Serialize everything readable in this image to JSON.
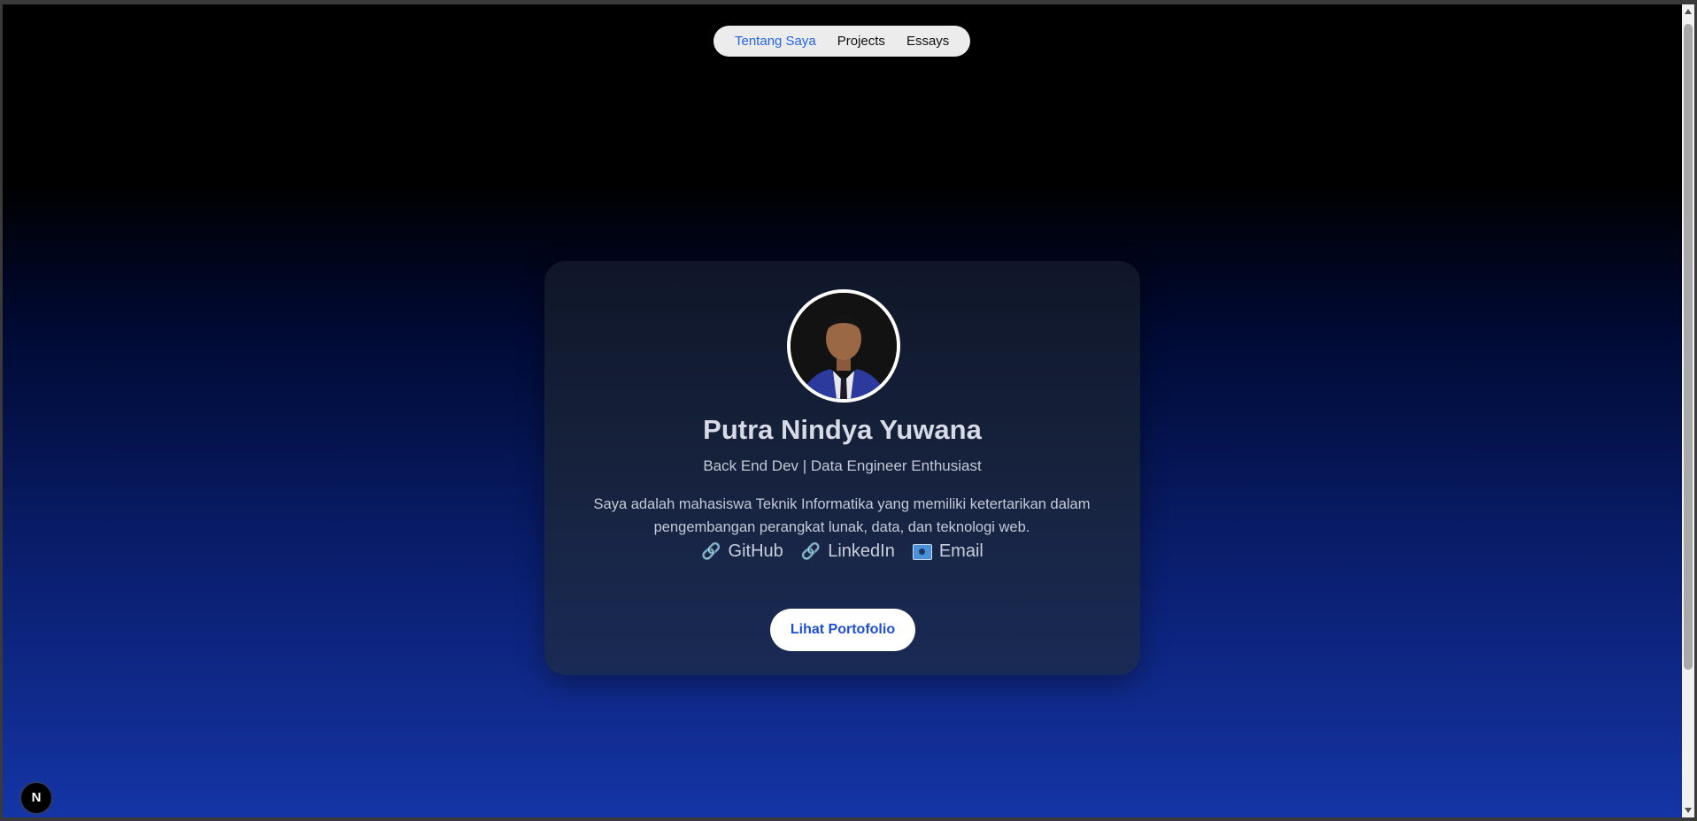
{
  "nav": {
    "items": [
      {
        "label": "Tentang Saya",
        "active": true
      },
      {
        "label": "Projects",
        "active": false
      },
      {
        "label": "Essays",
        "active": false
      }
    ]
  },
  "profile": {
    "name": "Putra Nindya Yuwana",
    "subtitle": "Back End Dev | Data Engineer Enthusiast",
    "bio": "Saya adalah mahasiswa Teknik Informatika yang memiliki ketertarikan dalam pengembangan perangkat lunak, data, dan teknologi web.",
    "links": [
      {
        "icon": "link-icon",
        "label": "GitHub"
      },
      {
        "icon": "link-icon",
        "label": "LinkedIn"
      },
      {
        "icon": "email-icon",
        "label": "Email"
      }
    ],
    "cta_label": "Lihat Portofolio"
  },
  "badge": {
    "label": "N"
  },
  "colors": {
    "accent": "#2563eb",
    "gradient_top": "#000000",
    "gradient_bottom": "#1535a6"
  }
}
